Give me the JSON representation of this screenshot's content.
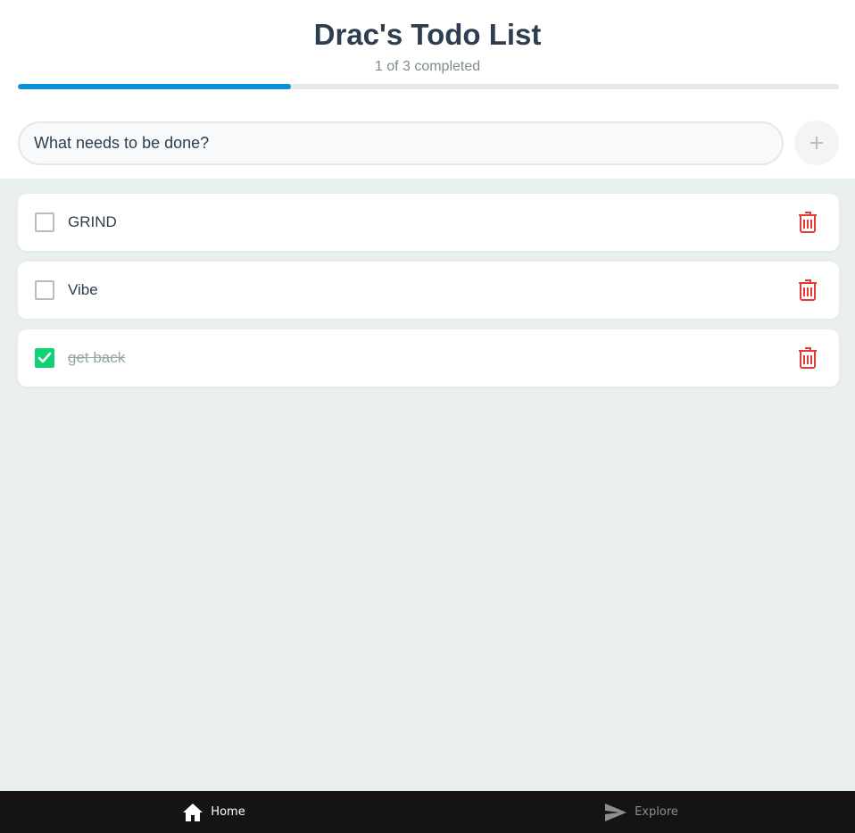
{
  "header": {
    "title": "Drac's Todo List",
    "subtitle": "1 of 3 completed",
    "progress_fraction": 0.333
  },
  "new_todo": {
    "placeholder": "What needs to be done?",
    "value": "",
    "add_icon": "plus-icon"
  },
  "todos": [
    {
      "text": "GRIND",
      "completed": false
    },
    {
      "text": "Vibe",
      "completed": false
    },
    {
      "text": "get back",
      "completed": true
    }
  ],
  "tabs": [
    {
      "label": "Home",
      "icon": "home-icon",
      "active": true
    },
    {
      "label": "Explore",
      "icon": "send-icon",
      "active": false
    }
  ],
  "colors": {
    "accent": "#0a8fd8",
    "check": "#10d275",
    "delete": "#e53935",
    "title": "#2c3e50"
  }
}
